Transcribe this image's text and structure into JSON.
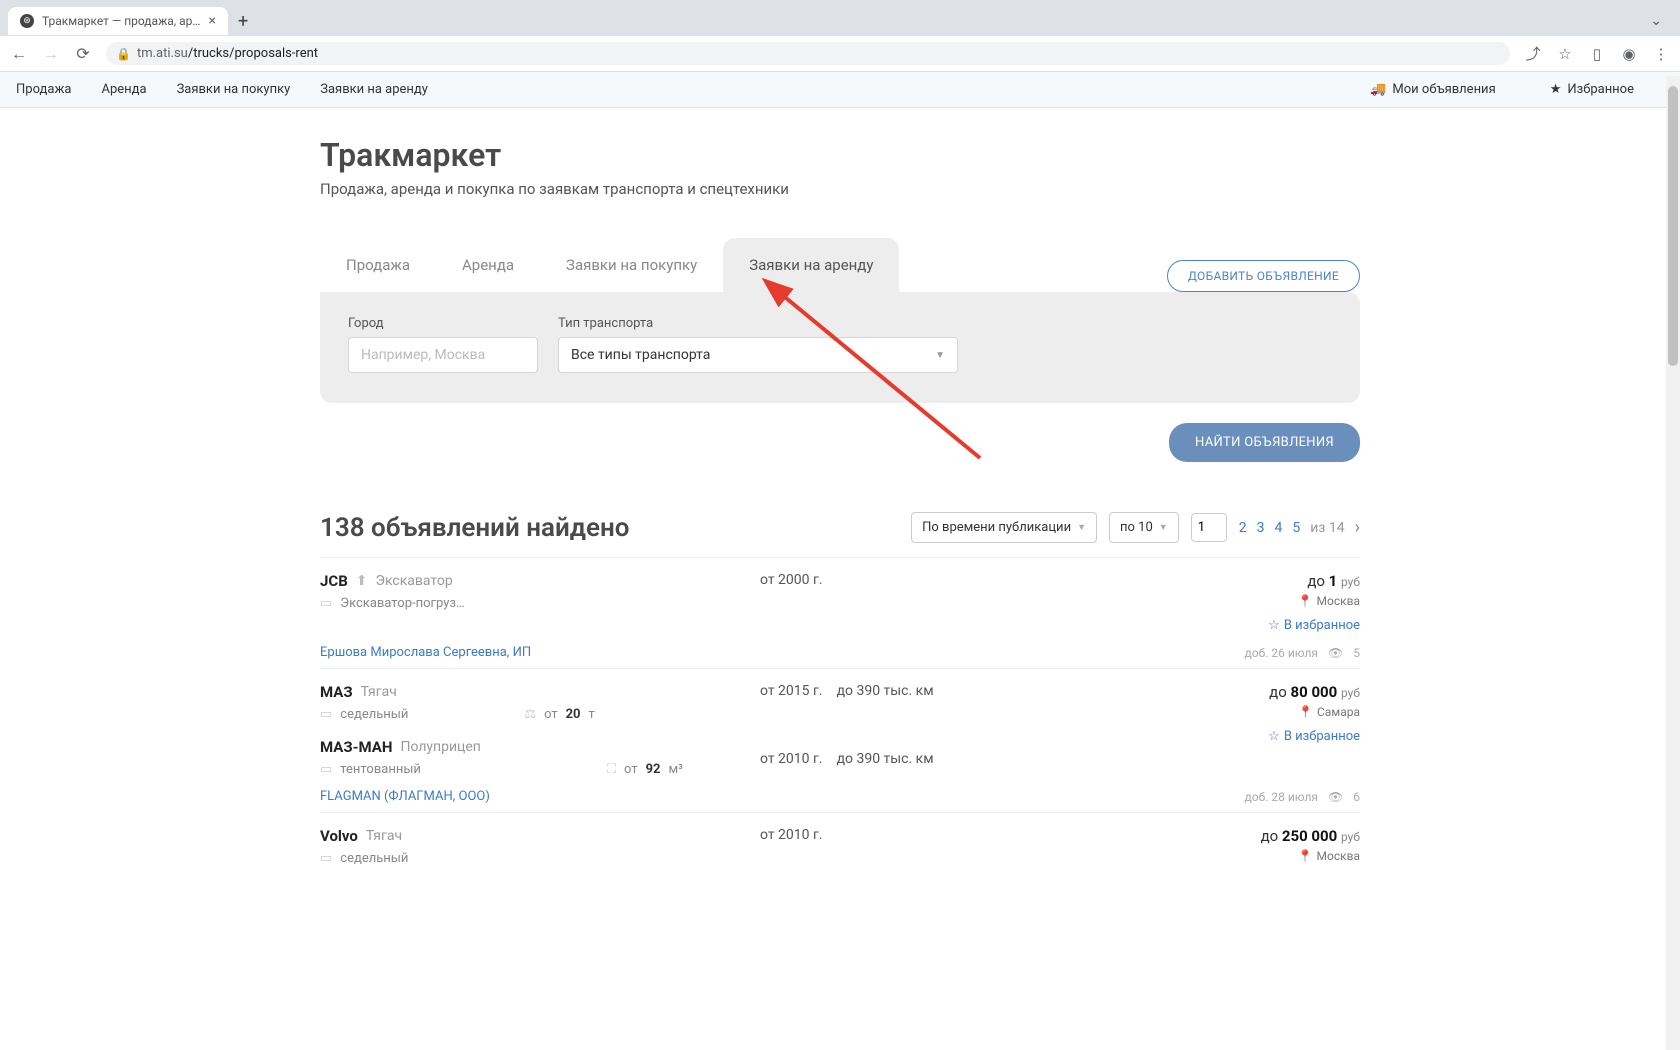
{
  "browser": {
    "tab_title": "Тракмаркет — продажа, арен…",
    "url_host": "tm.ati.su",
    "url_path": "/trucks/proposals-rent"
  },
  "site_nav": {
    "items": [
      "Продажа",
      "Аренда",
      "Заявки на покупку",
      "Заявки на аренду"
    ],
    "my_ads": "Мои объявления",
    "favorites": "Избранное"
  },
  "page": {
    "title": "Тракмаркет",
    "subtitle": "Продажа, аренда и покупка по заявкам транспорта и спецтехники"
  },
  "tabs": [
    "Продажа",
    "Аренда",
    "Заявки на покупку",
    "Заявки на аренду"
  ],
  "add_button": "ДОБАВИТЬ ОБЪЯВЛЕНИЕ",
  "filters": {
    "city_label": "Город",
    "city_placeholder": "Например, Москва",
    "type_label": "Тип транспорта",
    "type_value": "Все типы транспорта"
  },
  "search_button": "НАЙТИ ОБЪЯВЛЕНИЯ",
  "results": {
    "count_text": "138 объявлений найдено",
    "sort": "По времени публикации",
    "per_page": "по 10",
    "page_value": "1",
    "pages": [
      "2",
      "3",
      "4",
      "5"
    ],
    "of_label": "из 14"
  },
  "listings": [
    {
      "brand": "JCB",
      "type": "Экскаватор",
      "sub": "Экскаватор-погруз…",
      "mid_year": "от 2000 г.",
      "price_pre": "до ",
      "price_num": "1",
      "price_cur": "руб",
      "loc": "Москва",
      "fav": "В избранное",
      "seller": "Ершова Мирослава Сергеевна, ИП",
      "added": "доб. 26 июля",
      "views": "5"
    },
    {
      "brand": "МАЗ",
      "type": "Тягач",
      "sub": "седельный",
      "weight_pre": "от ",
      "weight_num": "20",
      "weight_unit": "т",
      "mid_year": "от 2015 г.",
      "mid_km": "до 390 тыс. км",
      "price_pre": "до ",
      "price_num": "80 000",
      "price_cur": "руб",
      "loc": "Самара",
      "fav": "В избранное",
      "sub2_brand": "МАЗ-МАН",
      "sub2_type": "Полуприцеп",
      "sub2_sub": "тентованный",
      "sub2_vol_pre": "от ",
      "sub2_vol_num": "92",
      "sub2_vol_unit": "м³",
      "sub2_mid_year": "от 2010 г.",
      "sub2_mid_km": "до 390 тыс. км",
      "seller": "FLAGMAN (ФЛАГМАН, ООО)",
      "added": "доб. 28 июля",
      "views": "6"
    },
    {
      "brand": "Volvo",
      "type": "Тягач",
      "sub": "седельный",
      "mid_year": "от 2010 г.",
      "price_pre": "до ",
      "price_num": "250 000",
      "price_cur": "руб",
      "loc": "Москва"
    }
  ]
}
